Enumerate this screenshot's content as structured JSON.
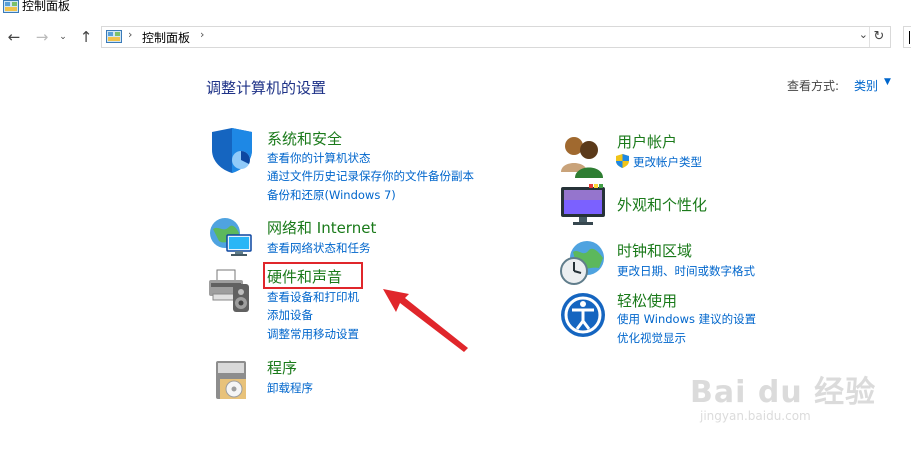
{
  "window": {
    "title": "控制面板"
  },
  "nav": {
    "back_icon": "back-arrow",
    "forward_icon": "forward-arrow",
    "recent_icon": "chevron-down",
    "up_icon": "up-arrow",
    "address": {
      "crumb": "控制面板",
      "separator": "›"
    },
    "refresh_icon": "refresh"
  },
  "main": {
    "heading": "调整计算机的设置",
    "view_by": {
      "label": "查看方式:",
      "value": "类别"
    }
  },
  "categories": {
    "system": {
      "title": "系统和安全",
      "links": [
        "查看你的计算机状态",
        "通过文件历史记录保存你的文件备份副本",
        "备份和还原(Windows 7)"
      ]
    },
    "network": {
      "title": "网络和 Internet",
      "links": [
        "查看网络状态和任务"
      ]
    },
    "hardware": {
      "title": "硬件和声音",
      "links": [
        "查看设备和打印机",
        "添加设备",
        "调整常用移动设置"
      ]
    },
    "programs": {
      "title": "程序",
      "links": [
        "卸载程序"
      ]
    },
    "users": {
      "title": "用户帐户",
      "links": [
        "更改帐户类型"
      ]
    },
    "appearance": {
      "title": "外观和个性化",
      "links": []
    },
    "clock": {
      "title": "时钟和区域",
      "links": [
        "更改日期、时间或数字格式"
      ]
    },
    "ease": {
      "title": "轻松使用",
      "links": [
        "使用 Windows 建议的设置",
        "优化视觉显示"
      ]
    }
  },
  "annotation": {
    "highlight_color": "#e0262b"
  },
  "watermark": {
    "brand": "Bai du 经验",
    "url": "jingyan.baidu.com"
  }
}
